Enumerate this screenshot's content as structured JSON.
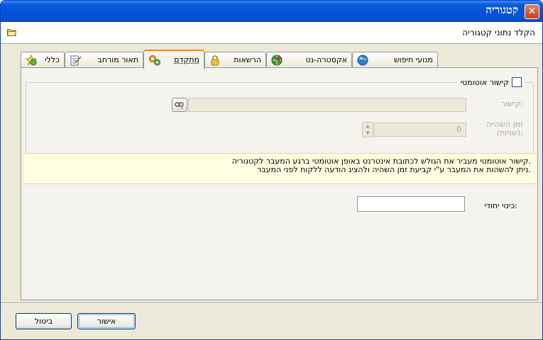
{
  "window": {
    "title": "קטגוריה",
    "close_glyph": "✕",
    "subheader_label": "הקלד נתוני קטגוריה"
  },
  "tabs": [
    {
      "label": "מנועי חיפוש",
      "icon": "search-engine-icon"
    },
    {
      "label": "אקסטרה-נט",
      "icon": "extranet-icon"
    },
    {
      "label": "הרשאות",
      "icon": "lock-icon"
    },
    {
      "label": "מתקדם",
      "icon": "gears-icon",
      "active": true
    },
    {
      "label": "תאור מורחב",
      "icon": "notepad-icon"
    },
    {
      "label": "כללי",
      "icon": "general-icon"
    }
  ],
  "advanced": {
    "auto_link_label": "קישור אוטומטי",
    "auto_link_checked": false,
    "link_label": "קישור:",
    "link_value": "",
    "delay_label_line1": "זמן השהייה",
    "delay_label_line2": "(שניות):",
    "delay_value": "0",
    "info_line1": "קישור אוטומטי מעביר את הגולש לכתובת אינטרנט באופן אוטומטי ברגע המעבר לקטגוריה.",
    "info_line2": "ניתן להשהות את המעבר ע\"י קביעת זמן השהיה ולהציג הודעה ללקוח לפני המעבר.",
    "unique_name_label": "כינוי יחודי:",
    "unique_name_value": ""
  },
  "buttons": {
    "ok_label": "אישור",
    "cancel_label": "ביטול"
  },
  "colors": {
    "titlebar": "#0453d8",
    "tab_active_accent": "#e68b2c",
    "info_background": "#ffffe1"
  }
}
